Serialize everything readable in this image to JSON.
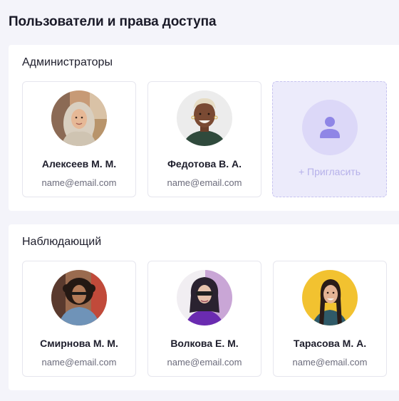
{
  "page": {
    "title": "Пользователи и права доступа"
  },
  "admins": {
    "title": "Администраторы",
    "users": [
      {
        "name": "Алексеев М. М.",
        "email": "name@email.com",
        "avatar": "avatar-woman-hijab"
      },
      {
        "name": "Федотова В. А.",
        "email": "name@email.com",
        "avatar": "avatar-woman-short-hair"
      }
    ],
    "invite": {
      "label": "+ Пригласить",
      "icon": "user-icon"
    }
  },
  "viewers": {
    "title": "Наблюдающий",
    "users": [
      {
        "name": "Смирнова М. М.",
        "email": "name@email.com",
        "avatar": "avatar-woman-curly-hair"
      },
      {
        "name": "Волкова Е. М.",
        "email": "name@email.com",
        "avatar": "avatar-woman-sunglasses"
      },
      {
        "name": "Тарасова М. А.",
        "email": "name@email.com",
        "avatar": "avatar-woman-yellow-bg"
      }
    ]
  },
  "colors": {
    "background": "#f4f4fa",
    "card_border": "#e6e6ee",
    "invite_bg": "#ecebfb",
    "invite_accent": "#8f86e6"
  }
}
